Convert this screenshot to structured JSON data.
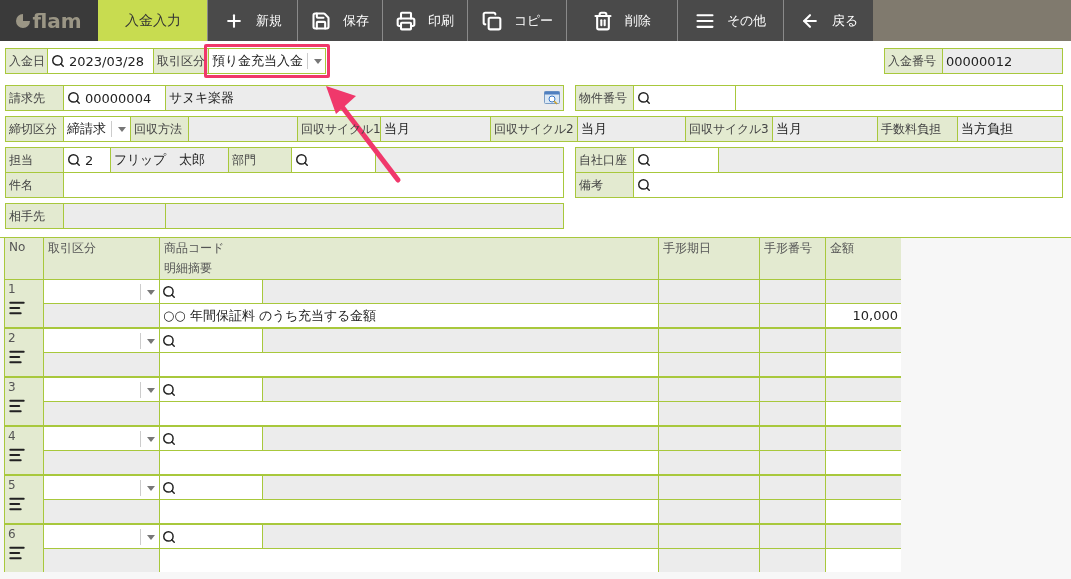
{
  "toolbar": {
    "logo": "flam",
    "tabs": [
      {
        "label": "入金入力",
        "selected": true
      }
    ],
    "buttons": [
      {
        "label": "新規"
      },
      {
        "label": "保存"
      },
      {
        "label": "印刷"
      },
      {
        "label": "コピー"
      },
      {
        "label": "削除"
      },
      {
        "label": "その他"
      },
      {
        "label": "戻る"
      }
    ]
  },
  "form": {
    "sections": [
      {
        "boxes": [
          {
            "lines": [
              [
                {
                  "kind": "label",
                  "text": "入金日"
                },
                {
                  "kind": "search",
                  "value": "2023/03/28"
                },
                {
                  "kind": "label",
                  "text": "取引区分"
                },
                {
                  "kind": "select",
                  "value": "預り金充当入金",
                  "annotated": true
                }
              ]
            ]
          },
          {
            "lines": [
              [
                {
                  "kind": "label",
                  "text": "入金番号"
                },
                {
                  "kind": "display",
                  "value": "00000012"
                }
              ]
            ]
          }
        ]
      },
      {
        "boxes": [
          {
            "lines": [
              [
                {
                  "kind": "label",
                  "text": "請求先"
                },
                {
                  "kind": "search",
                  "value": "00000004"
                },
                {
                  "kind": "picker",
                  "value": "サヌキ楽器"
                }
              ]
            ]
          },
          {
            "lines": [
              [
                {
                  "kind": "label",
                  "text": "物件番号"
                },
                {
                  "kind": "search"
                },
                {
                  "kind": "input"
                }
              ]
            ]
          }
        ]
      },
      {
        "boxes": [
          {
            "lines": [
              [
                {
                  "kind": "label",
                  "text": "締切区分"
                },
                {
                  "kind": "select",
                  "value": "締請求"
                },
                {
                  "kind": "label",
                  "text": "回収方法"
                },
                {
                  "kind": "display"
                },
                {
                  "kind": "label",
                  "text": "回収サイクル1"
                },
                {
                  "kind": "display",
                  "value": "当月"
                },
                {
                  "kind": "label",
                  "text": "回収サイクル2"
                },
                {
                  "kind": "display",
                  "value": "当月"
                },
                {
                  "kind": "label",
                  "text": "回収サイクル3"
                },
                {
                  "kind": "display",
                  "value": "当月"
                },
                {
                  "kind": "label",
                  "text": "手数料負担"
                },
                {
                  "kind": "display",
                  "value": "当方負担"
                }
              ]
            ]
          }
        ]
      },
      {
        "boxes": [
          {
            "lines": [
              [
                {
                  "kind": "label",
                  "text": "担当"
                },
                {
                  "kind": "search",
                  "value": "2"
                },
                {
                  "kind": "display",
                  "value": "フリップ　太郎"
                },
                {
                  "kind": "label",
                  "text": "部門"
                },
                {
                  "kind": "search"
                },
                {
                  "kind": "display"
                }
              ],
              [
                {
                  "kind": "label",
                  "text": "件名"
                },
                {
                  "kind": "input"
                }
              ]
            ]
          },
          {
            "lines": [
              [
                {
                  "kind": "label",
                  "text": "自社口座"
                },
                {
                  "kind": "search"
                },
                {
                  "kind": "display"
                }
              ],
              [
                {
                  "kind": "label",
                  "text": "備考"
                },
                {
                  "kind": "search"
                }
              ]
            ]
          }
        ]
      },
      {
        "boxes": [
          {
            "lines": [
              [
                {
                  "kind": "label",
                  "text": "相手先"
                },
                {
                  "kind": "display"
                },
                {
                  "kind": "display"
                }
              ]
            ]
          }
        ]
      }
    ]
  },
  "table": {
    "columns": [
      {
        "labels": [
          "No"
        ]
      },
      {
        "labels": [
          "取引区分"
        ]
      },
      {
        "labels": [
          "商品コード",
          "明細摘要"
        ]
      },
      {
        "labels": [
          "手形期日"
        ]
      },
      {
        "labels": [
          "手形番号"
        ]
      },
      {
        "labels": [
          "金額"
        ]
      }
    ],
    "rows": [
      {
        "no": "1",
        "memo": "○○ 年間保証料 のうち充当する金額",
        "amount": "10,000"
      },
      {
        "no": "2"
      },
      {
        "no": "3"
      },
      {
        "no": "4"
      },
      {
        "no": "5"
      },
      {
        "no": "6"
      }
    ]
  }
}
